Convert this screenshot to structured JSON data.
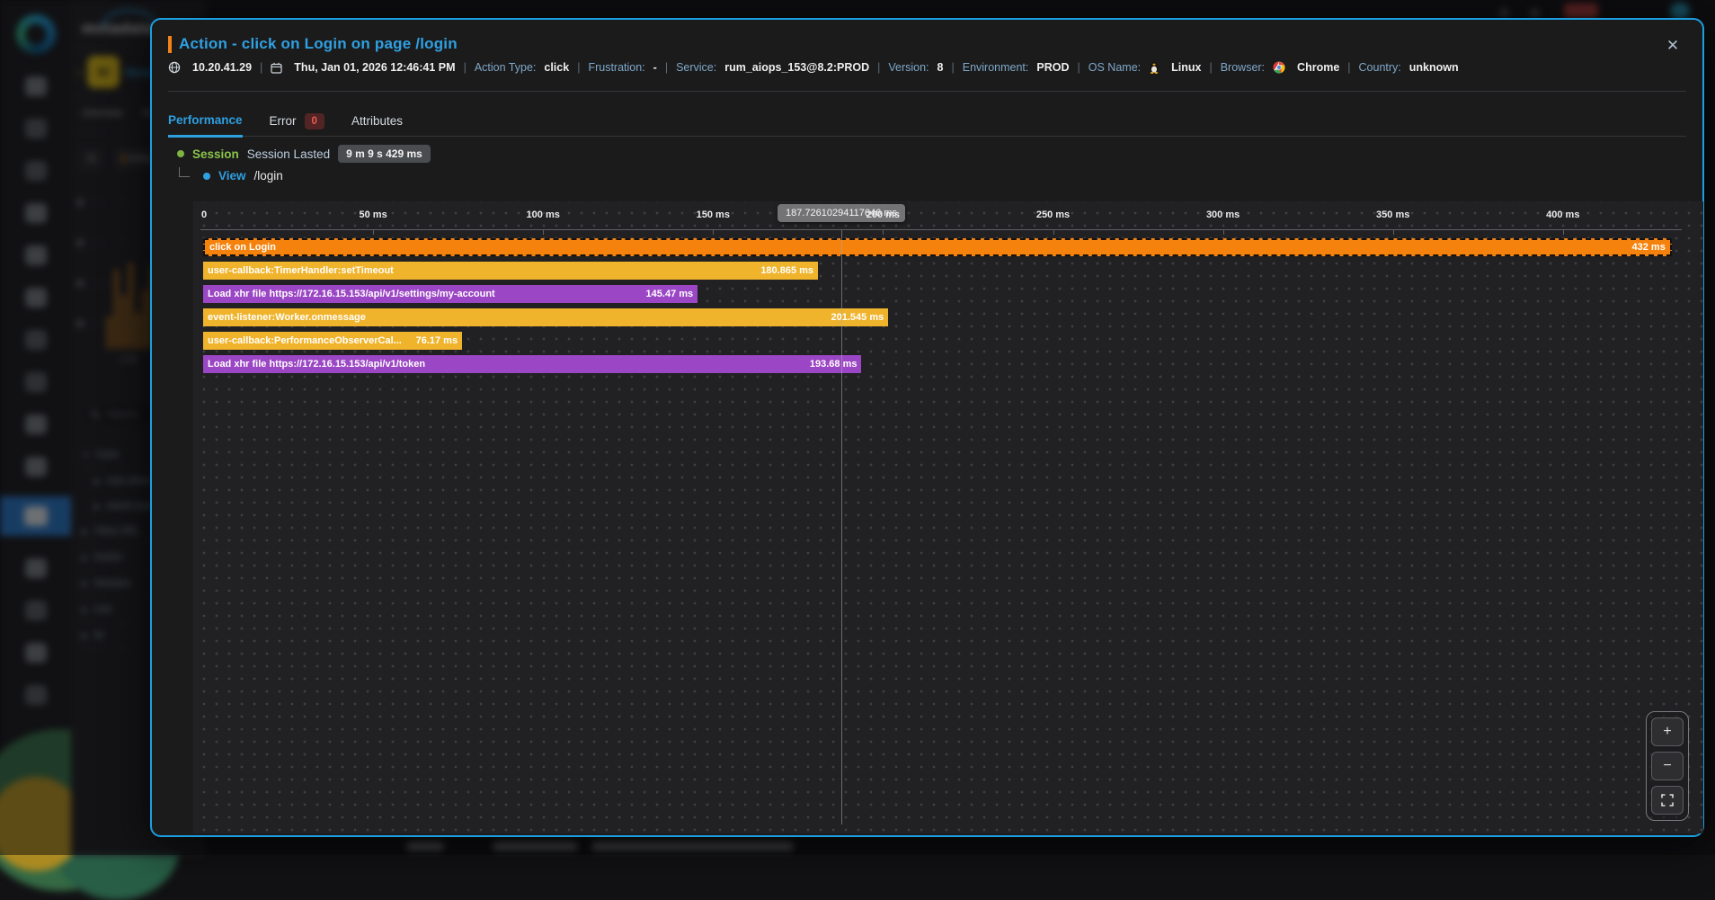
{
  "colors": {
    "accent_blue": "#1b9fe0",
    "orange": "#f5820d",
    "yellow": "#f0b42c",
    "purple": "#9b46c4",
    "green": "#8bc34a",
    "error_red": "#ea5b52"
  },
  "background": {
    "logo_text": "motadata",
    "panel": {
      "collapsed_title": "Motad",
      "folder_glyph": "M",
      "tabs": [
        "Overview",
        "Brows"
      ],
      "toolbar_left": "In",
      "toolbar_right": "Actions",
      "mini_chart_bars": [
        36,
        88,
        60,
        96,
        40,
        66,
        92,
        30,
        54,
        99,
        78
      ],
      "mini_chart_time_label": "1:00",
      "search_placeholder": "Search",
      "tree": [
        {
          "label": "Core",
          "level": 0,
          "expanded": true
        },
        {
          "label": "rum.view.action",
          "level": 1,
          "expanded": false
        },
        {
          "label": "event.source",
          "level": 1,
          "expanded": false
        },
        {
          "label": "View URL",
          "level": 0,
          "expanded": false
        },
        {
          "label": "Action",
          "level": 0,
          "expanded": false
        },
        {
          "label": "Session",
          "level": 0,
          "expanded": false
        },
        {
          "label": "rum",
          "level": 0,
          "expanded": false
        },
        {
          "label": "Id",
          "level": 0,
          "expanded": false
        }
      ]
    }
  },
  "modal": {
    "title": "Action - click on Login on page /login",
    "close_glyph": "✕",
    "meta": {
      "ip": "10.20.41.29",
      "datetime": "Thu, Jan 01, 2026 12:46:41 PM",
      "fields": [
        {
          "label": "Action Type:",
          "value": "click"
        },
        {
          "label": "Frustration:",
          "value": "-"
        },
        {
          "label": "Service:",
          "value": "rum_aiops_153@8.2:PROD"
        },
        {
          "label": "Version:",
          "value": "8"
        },
        {
          "label": "Environment:",
          "value": "PROD"
        },
        {
          "label": "OS Name:",
          "value": "Linux"
        },
        {
          "label": "Browser:",
          "value": "Chrome"
        },
        {
          "label": "Country:",
          "value": "unknown"
        }
      ]
    },
    "tabs": [
      {
        "label": "Performance",
        "active": true
      },
      {
        "label": "Error",
        "badge": "0"
      },
      {
        "label": "Attributes"
      }
    ],
    "session": {
      "name": "Session",
      "lasted_label": "Session Lasted",
      "duration": "9 m 9 s 429 ms"
    },
    "view": {
      "name": "View",
      "path": "/login"
    }
  },
  "chart_data": {
    "type": "bar",
    "subtype": "horizontal-waterfall-timeline",
    "x_unit": "ms",
    "xlim": [
      0,
      440
    ],
    "grid": "dotted",
    "x_ticks": [
      {
        "ms": 0,
        "label": "0"
      },
      {
        "ms": 50,
        "label": "50 ms"
      },
      {
        "ms": 100,
        "label": "100 ms"
      },
      {
        "ms": 150,
        "label": "150 ms"
      },
      {
        "ms": 200,
        "label": "200 ms"
      },
      {
        "ms": 250,
        "label": "250 ms"
      },
      {
        "ms": 300,
        "label": "300 ms"
      },
      {
        "ms": 350,
        "label": "350 ms"
      },
      {
        "ms": 400,
        "label": "400 ms"
      }
    ],
    "bars": [
      {
        "label": "click on Login",
        "value_ms": 432,
        "display": "432 ms",
        "color": "orange",
        "selected": true
      },
      {
        "label": "user-callback:TimerHandler:setTimeout",
        "value_ms": 180.865,
        "display": "180.865 ms",
        "color": "yellow",
        "selected": false
      },
      {
        "label": "Load xhr file https://172.16.15.153/api/v1/settings/my-account",
        "value_ms": 145.47,
        "display": "145.47 ms",
        "color": "purple",
        "selected": false
      },
      {
        "label": "event-listener:Worker.onmessage",
        "value_ms": 201.545,
        "display": "201.545 ms",
        "color": "yellow",
        "selected": false
      },
      {
        "label": "user-callback:PerformanceObserverCal...",
        "value_ms": 76.17,
        "display": "76.17 ms",
        "color": "yellow",
        "selected": false
      },
      {
        "label": "Load xhr file https://172.16.15.153/api/v1/token",
        "value_ms": 193.68,
        "display": "193.68 ms",
        "color": "purple",
        "selected": false
      }
    ],
    "crosshair_tooltip": {
      "text": "187.72610294117646 ms",
      "ms": 187.72610294117646
    },
    "zoom_controls": {
      "zoom_in": "+",
      "zoom_out": "−"
    }
  }
}
